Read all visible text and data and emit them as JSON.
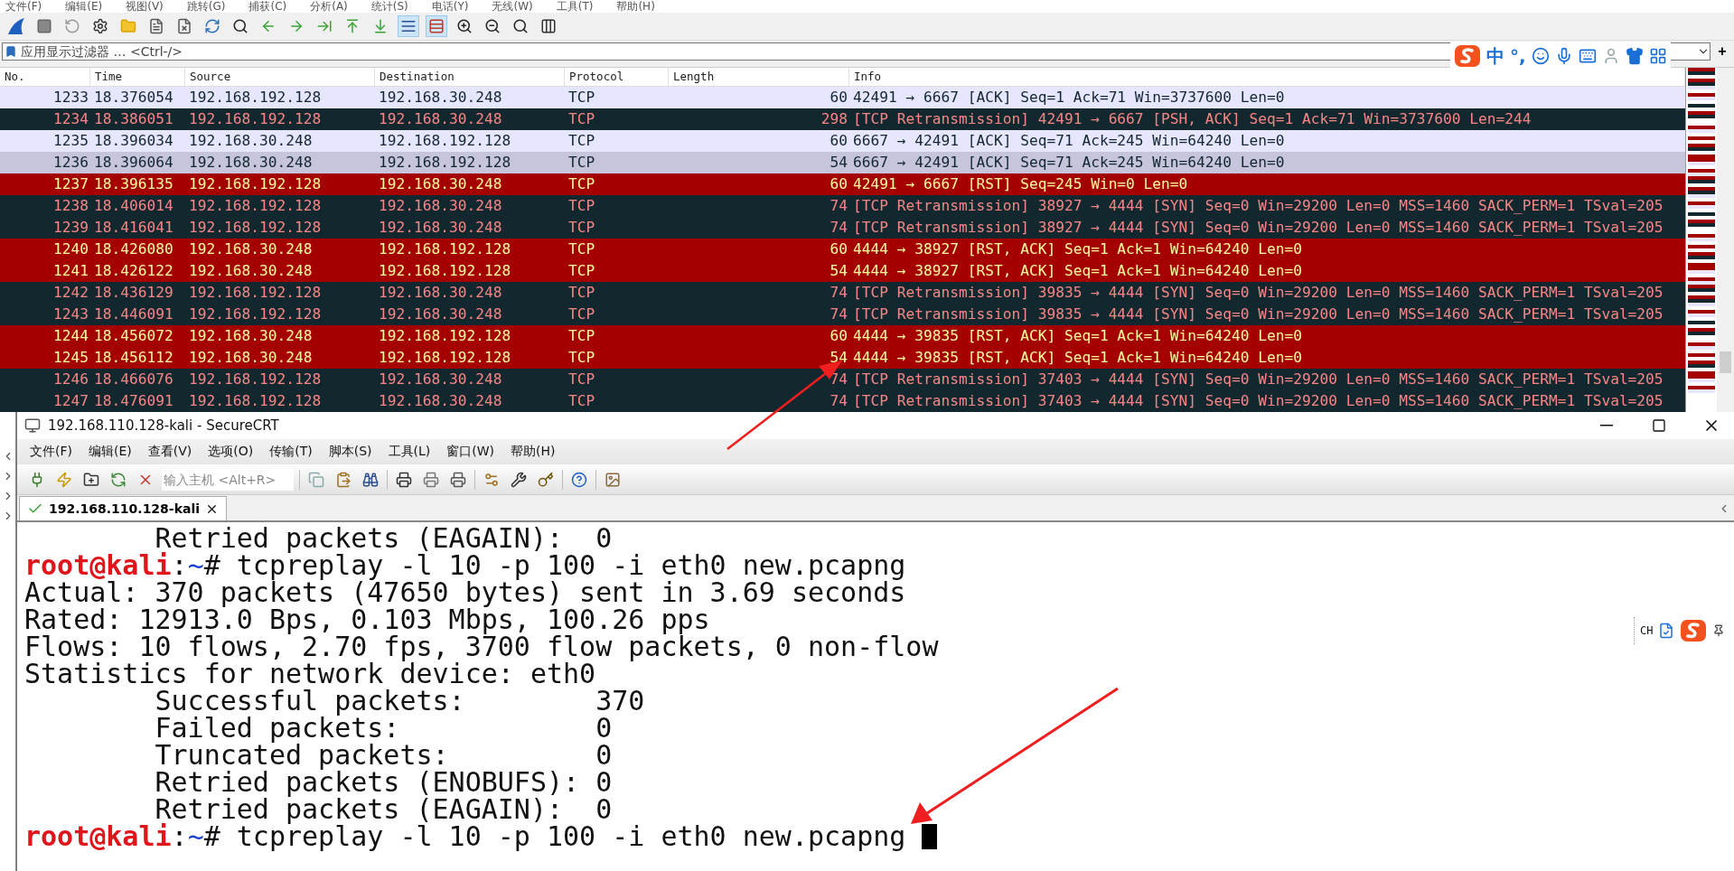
{
  "wireshark": {
    "menu": [
      "文件(F)",
      "编辑(E)",
      "视图(V)",
      "跳转(G)",
      "捕获(C)",
      "分析(A)",
      "统计(S)",
      "电话(Y)",
      "无线(W)",
      "工具(T)",
      "帮助(H)"
    ],
    "toolbar": {
      "auto_scroll_on": true,
      "colorize_on": true
    },
    "filter": {
      "placeholder": "应用显示过滤器 … <Ctrl-/>",
      "add_button": "+"
    },
    "columns": [
      "No.",
      "Time",
      "Source",
      "Destination",
      "Protocol",
      "Length",
      "Info"
    ],
    "rows": [
      {
        "no": "1233",
        "time": "18.376054",
        "source": "192.168.192.128",
        "destination": "192.168.30.248",
        "protocol": "TCP",
        "length": "60",
        "info": "42491 → 6667 [ACK] Seq=1 Ack=71 Win=3737600 Len=0",
        "kind": "light"
      },
      {
        "no": "1234",
        "time": "18.386051",
        "source": "192.168.192.128",
        "destination": "192.168.30.248",
        "protocol": "TCP",
        "length": "298",
        "info": "[TCP Retransmission] 42491 → 6667 [PSH, ACK] Seq=1 Ack=71 Win=3737600 Len=244",
        "kind": "bad"
      },
      {
        "no": "1235",
        "time": "18.396034",
        "source": "192.168.30.248",
        "destination": "192.168.192.128",
        "protocol": "TCP",
        "length": "60",
        "info": "6667 → 42491 [ACK] Seq=71 Ack=245 Win=64240 Len=0",
        "kind": "light"
      },
      {
        "no": "1236",
        "time": "18.396064",
        "source": "192.168.30.248",
        "destination": "192.168.192.128",
        "protocol": "TCP",
        "length": "54",
        "info": "6667 → 42491 [ACK] Seq=71 Ack=245 Win=64240 Len=0",
        "kind": "light_marked"
      },
      {
        "no": "1237",
        "time": "18.396135",
        "source": "192.168.192.128",
        "destination": "192.168.30.248",
        "protocol": "TCP",
        "length": "60",
        "info": "42491 → 6667 [RST] Seq=245 Win=0 Len=0",
        "kind": "reset"
      },
      {
        "no": "1238",
        "time": "18.406014",
        "source": "192.168.192.128",
        "destination": "192.168.30.248",
        "protocol": "TCP",
        "length": "74",
        "info": "[TCP Retransmission] 38927 → 4444 [SYN] Seq=0 Win=29200 Len=0 MSS=1460 SACK_PERM=1 TSval=205",
        "kind": "bad"
      },
      {
        "no": "1239",
        "time": "18.416041",
        "source": "192.168.192.128",
        "destination": "192.168.30.248",
        "protocol": "TCP",
        "length": "74",
        "info": "[TCP Retransmission] 38927 → 4444 [SYN] Seq=0 Win=29200 Len=0 MSS=1460 SACK_PERM=1 TSval=205",
        "kind": "bad"
      },
      {
        "no": "1240",
        "time": "18.426080",
        "source": "192.168.30.248",
        "destination": "192.168.192.128",
        "protocol": "TCP",
        "length": "60",
        "info": "4444 → 38927 [RST, ACK] Seq=1 Ack=1 Win=64240 Len=0",
        "kind": "reset"
      },
      {
        "no": "1241",
        "time": "18.426122",
        "source": "192.168.30.248",
        "destination": "192.168.192.128",
        "protocol": "TCP",
        "length": "54",
        "info": "4444 → 38927 [RST, ACK] Seq=1 Ack=1 Win=64240 Len=0",
        "kind": "reset"
      },
      {
        "no": "1242",
        "time": "18.436129",
        "source": "192.168.192.128",
        "destination": "192.168.30.248",
        "protocol": "TCP",
        "length": "74",
        "info": "[TCP Retransmission] 39835 → 4444 [SYN] Seq=0 Win=29200 Len=0 MSS=1460 SACK_PERM=1 TSval=205",
        "kind": "bad"
      },
      {
        "no": "1243",
        "time": "18.446091",
        "source": "192.168.192.128",
        "destination": "192.168.30.248",
        "protocol": "TCP",
        "length": "74",
        "info": "[TCP Retransmission] 39835 → 4444 [SYN] Seq=0 Win=29200 Len=0 MSS=1460 SACK_PERM=1 TSval=205",
        "kind": "bad"
      },
      {
        "no": "1244",
        "time": "18.456072",
        "source": "192.168.30.248",
        "destination": "192.168.192.128",
        "protocol": "TCP",
        "length": "60",
        "info": "4444 → 39835 [RST, ACK] Seq=1 Ack=1 Win=64240 Len=0",
        "kind": "reset"
      },
      {
        "no": "1245",
        "time": "18.456112",
        "source": "192.168.30.248",
        "destination": "192.168.192.128",
        "protocol": "TCP",
        "length": "54",
        "info": "4444 → 39835 [RST, ACK] Seq=1 Ack=1 Win=64240 Len=0",
        "kind": "reset"
      },
      {
        "no": "1246",
        "time": "18.466076",
        "source": "192.168.192.128",
        "destination": "192.168.30.248",
        "protocol": "TCP",
        "length": "74",
        "info": "[TCP Retransmission] 37403 → 4444 [SYN] Seq=0 Win=29200 Len=0 MSS=1460 SACK_PERM=1 TSval=205",
        "kind": "bad"
      },
      {
        "no": "1247",
        "time": "18.476091",
        "source": "192.168.192.128",
        "destination": "192.168.30.248",
        "protocol": "TCP",
        "length": "74",
        "info": "[TCP Retransmission] 37403 → 4444 [SYN] Seq=0 Win=29200 Len=0 MSS=1460 SACK_PERM=1 TSval=205",
        "kind": "bad"
      }
    ]
  },
  "ime_bar": {
    "mode": "中",
    "punctuation": "°,"
  },
  "securecrt": {
    "title": "192.168.110.128-kali - SecureCRT",
    "menu": [
      "文件(F)",
      "编辑(E)",
      "查看(V)",
      "选项(O)",
      "传输(T)",
      "脚本(S)",
      "工具(L)",
      "窗口(W)",
      "帮助(H)"
    ],
    "host_field": {
      "placeholder": "输入主机 <Alt+R>"
    },
    "tabs": [
      {
        "label": "192.168.110.128-kali",
        "selected": true,
        "connected": true
      }
    ],
    "terminal": [
      {
        "parts": [
          {
            "kind": "plain",
            "text": "        Retried packets (EAGAIN):  0"
          }
        ],
        "cursor": false
      },
      {
        "parts": [
          {
            "kind": "user",
            "text": "root@kali"
          },
          {
            "kind": "plain",
            "text": ":"
          },
          {
            "kind": "path",
            "text": "~"
          },
          {
            "kind": "plain",
            "text": "# tcpreplay -l 10 -p 100 -i eth0 new.pcapng"
          }
        ],
        "cursor": false
      },
      {
        "parts": [
          {
            "kind": "plain",
            "text": "Actual: 370 packets (47650 bytes) sent in 3.69 seconds"
          }
        ],
        "cursor": false
      },
      {
        "parts": [
          {
            "kind": "plain",
            "text": "Rated: 12913.0 Bps, 0.103 Mbps, 100.26 pps"
          }
        ],
        "cursor": false
      },
      {
        "parts": [
          {
            "kind": "plain",
            "text": "Flows: 10 flows, 2.70 fps, 3700 flow packets, 0 non-flow"
          }
        ],
        "cursor": false
      },
      {
        "parts": [
          {
            "kind": "plain",
            "text": "Statistics for network device: eth0"
          }
        ],
        "cursor": false
      },
      {
        "parts": [
          {
            "kind": "plain",
            "text": "        Successful packets:        370"
          }
        ],
        "cursor": false
      },
      {
        "parts": [
          {
            "kind": "plain",
            "text": "        Failed packets:            0"
          }
        ],
        "cursor": false
      },
      {
        "parts": [
          {
            "kind": "plain",
            "text": "        Truncated packets:         0"
          }
        ],
        "cursor": false
      },
      {
        "parts": [
          {
            "kind": "plain",
            "text": "        Retried packets (ENOBUFS): 0"
          }
        ],
        "cursor": false
      },
      {
        "parts": [
          {
            "kind": "plain",
            "text": "        Retried packets (EAGAIN):  0"
          }
        ],
        "cursor": false
      },
      {
        "parts": [
          {
            "kind": "user",
            "text": "root@kali"
          },
          {
            "kind": "plain",
            "text": ":"
          },
          {
            "kind": "path",
            "text": "~"
          },
          {
            "kind": "plain",
            "text": "# tcpreplay -l 10 -p 100 -i eth0 new.pcapng "
          }
        ],
        "cursor": true
      }
    ]
  },
  "ime_float": {
    "label": "CH"
  }
}
